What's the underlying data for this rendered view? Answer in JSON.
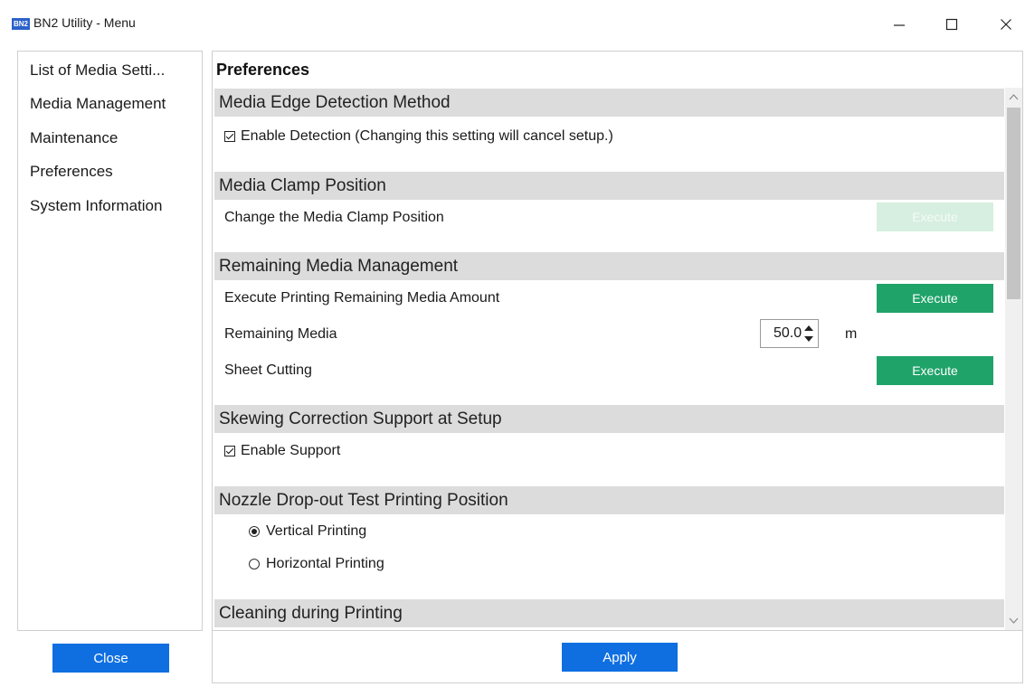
{
  "window": {
    "app_icon_text": "BN2",
    "title": "BN2 Utility - Menu"
  },
  "sidebar": {
    "items": [
      {
        "label": "List of Media Setti..."
      },
      {
        "label": "Media Management"
      },
      {
        "label": "Maintenance"
      },
      {
        "label": "Preferences"
      },
      {
        "label": "System Information"
      }
    ],
    "close_label": "Close"
  },
  "main": {
    "title": "Preferences",
    "sections": {
      "edge": {
        "header": "Media Edge Detection Method",
        "checkbox_label": "Enable Detection (Changing this setting will cancel setup.)",
        "checked": true
      },
      "clamp": {
        "header": "Media Clamp Position",
        "row_label": "Change the Media Clamp Position",
        "button_label": "Execute",
        "button_enabled": false
      },
      "remaining": {
        "header": "Remaining Media Management",
        "print_label": "Execute Printing Remaining Media Amount",
        "print_button": "Execute",
        "amount_label": "Remaining Media",
        "amount_value": "50.0",
        "amount_unit": "m",
        "cut_label": "Sheet Cutting",
        "cut_button": "Execute"
      },
      "skew": {
        "header": "Skewing Correction Support at Setup",
        "checkbox_label": "Enable Support",
        "checked": true
      },
      "nozzle": {
        "header": "Nozzle Drop-out Test Printing Position",
        "options": [
          {
            "label": "Vertical Printing",
            "selected": true
          },
          {
            "label": "Horizontal Printing",
            "selected": false
          }
        ]
      },
      "cleaning": {
        "header": "Cleaning during Printing"
      }
    },
    "apply_label": "Apply"
  },
  "colors": {
    "execute_green": "#1fa369",
    "execute_disabled": "#d7efe0",
    "primary_blue": "#0f6fe1",
    "section_gray": "#dcdcdc"
  }
}
